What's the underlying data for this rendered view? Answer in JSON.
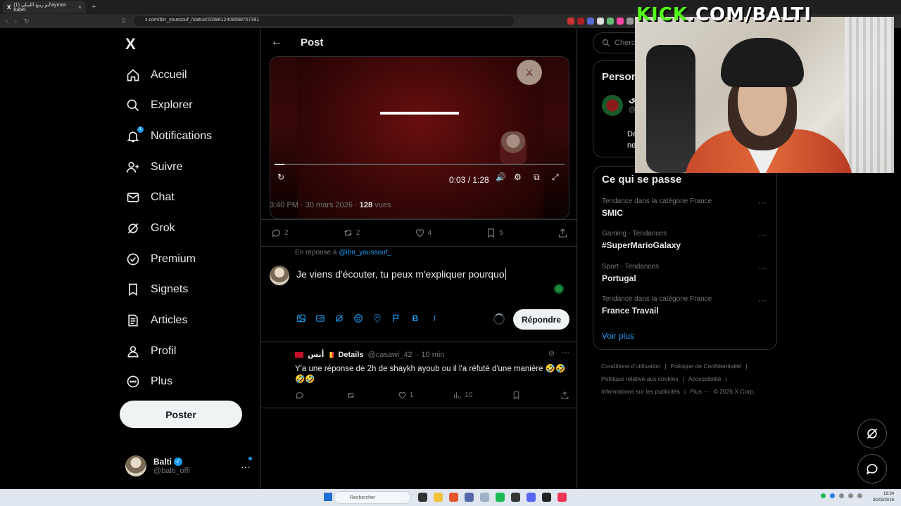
{
  "browser": {
    "tab_title": "(1) ابو ربيع الليبلي\\ayman babel",
    "tab_icon": "X",
    "url": "x.com/ibn_youssouf_/status/2038612409598767391"
  },
  "sidebar": {
    "logo": "X",
    "items": [
      {
        "label": "Accueil",
        "icon": "home-icon"
      },
      {
        "label": "Explorer",
        "icon": "search-icon"
      },
      {
        "label": "Notifications",
        "icon": "bell-icon",
        "badge": "1"
      },
      {
        "label": "Suivre",
        "icon": "person-add-icon"
      },
      {
        "label": "Chat",
        "icon": "mail-icon"
      },
      {
        "label": "Grok",
        "icon": "grok-icon"
      },
      {
        "label": "Premium",
        "icon": "premium-check-icon"
      },
      {
        "label": "Signets",
        "icon": "bookmark-icon"
      },
      {
        "label": "Articles",
        "icon": "article-icon"
      },
      {
        "label": "Profil",
        "icon": "profile-icon"
      },
      {
        "label": "Plus",
        "icon": "more-circle-icon"
      }
    ],
    "post_button": "Poster",
    "account": {
      "name": "Balti",
      "handle": "@balti_offi"
    }
  },
  "main": {
    "title": "Post",
    "video": {
      "time": "0:03 / 1:28",
      "progress": 0.034
    },
    "meta": {
      "time": "3:40 PM · 30 mars 2026 · ",
      "views_count": "128",
      "views_label": " vues"
    },
    "actions": {
      "replies": "2",
      "reposts": "2",
      "likes": "4",
      "bookmarks": "5"
    },
    "reply_to_prefix": "En réponse à ",
    "reply_to_handle": "@ibn_youssouf_",
    "compose_text": "Je viens d'écouter, tu peux m'expliquer pourquo",
    "reply_button": "Répondre",
    "reply_tweet": {
      "name": "أنس",
      "details": "Details",
      "handle": "@casawi_42",
      "time": "· 10 min",
      "text": "Y'a une réponse de 2h de shaykh ayoub ou il l'a réfuté d'une manière 🤣🤣🤣🤣",
      "replies": "",
      "reposts": "",
      "likes": "1",
      "views": "10"
    }
  },
  "right": {
    "search_placeholder": "Cherch",
    "persons": {
      "title": "Person",
      "name": "وي",
      "handle": "@",
      "bio1": "De",
      "bio2": "ne"
    },
    "trends_title": "Ce qui se passe",
    "trends": [
      {
        "category": "Tendance dans la catégorie France",
        "name": "SMIC"
      },
      {
        "category": "Gaming · Tendances",
        "name": "#SuperMarioGalaxy"
      },
      {
        "category": "Sport · Tendances",
        "name": "Portugal"
      },
      {
        "category": "Tendance dans la catégorie France",
        "name": "France Travail"
      }
    ],
    "see_more": "Voir plus",
    "footer": [
      "Conditions d'utilisation",
      "|",
      "Politique de Confidentialité",
      "|",
      "Politique relative aux cookies",
      "|",
      "Accessibilité",
      "|",
      "Informations sur les publicités",
      "|",
      "Plus ···",
      "© 2026 X Corp."
    ]
  },
  "overlay": {
    "kick_k": "KICK",
    "kick_rest": ".COM/BALTI"
  },
  "taskbar": {
    "search": "Rechercher",
    "time": "18:34",
    "date": "30/03/2026"
  }
}
